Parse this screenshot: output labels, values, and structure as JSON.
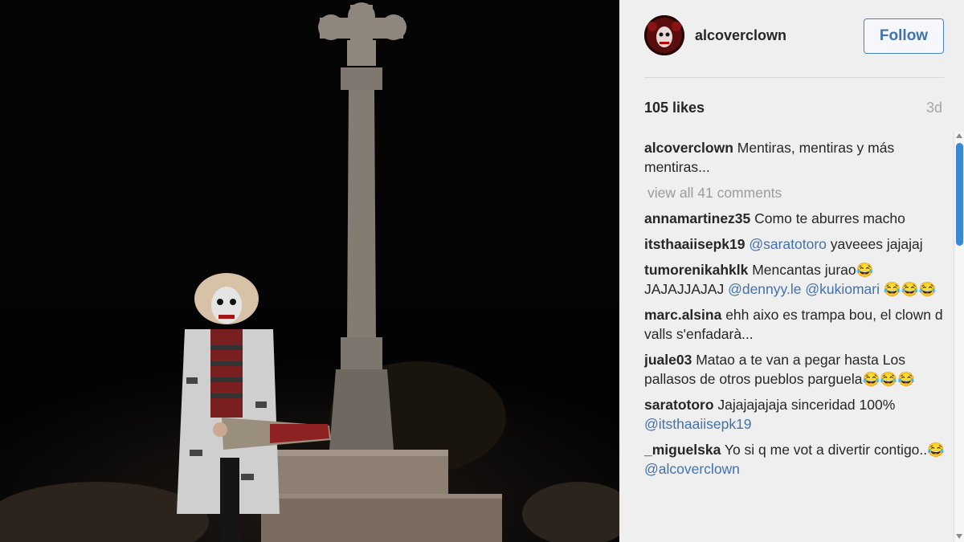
{
  "post": {
    "username": "alcoverclown",
    "follow_label": "Follow",
    "likes": "105 likes",
    "time": "3d"
  },
  "caption": {
    "user": "alcoverclown",
    "text": "Mentiras, mentiras y más mentiras..."
  },
  "view_all_comments": "view all 41 comments",
  "comments": [
    {
      "user": "annamartinez35",
      "text": "Como te aburres macho"
    },
    {
      "user": "itsthaaiisepk19",
      "mention": "@saratotoro",
      "text": "yaveees jajajaj"
    },
    {
      "user": "tumorenikahklk",
      "text": "Mencantas jurao😂JAJAJJAJAJ",
      "mention": "@dennyy.le",
      "mention2": "@kukiomari",
      "text2": "😂😂😂"
    },
    {
      "user": "marc.alsina",
      "text": "ehh aixo es trampa bou, el clown d valls s'enfadarà..."
    },
    {
      "user": "juale03",
      "text": "Matao a te van a pegar hasta Los pallasos de otros pueblos parguela😂😂😂"
    },
    {
      "user": "saratotoro",
      "text": "Jajajajajaja sinceridad 100%",
      "mention": "@itsthaaiisepk19"
    },
    {
      "user": "_miguelska",
      "text": "Yo si q me vot a divertir contigo..😂",
      "mention": "@alcoverclown"
    }
  ],
  "icons": {
    "avatar": "clown-avatar",
    "scroll_up": "scroll-up-arrow-icon",
    "scroll_down": "scroll-down-arrow-icon"
  },
  "colors": {
    "follow_text": "#3f72af",
    "follow_border": "#4a82c3",
    "mention": "#3f72af",
    "scroll_thumb": "#3a88d2"
  }
}
